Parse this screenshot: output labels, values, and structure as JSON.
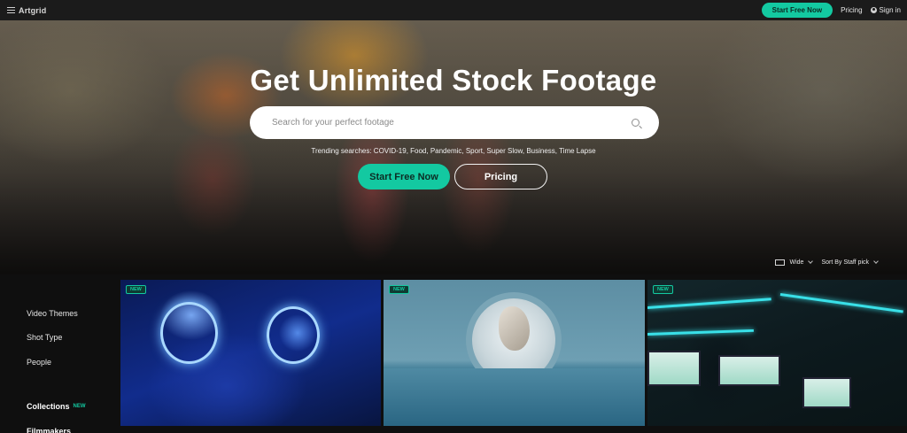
{
  "header": {
    "logo": "Artgrid",
    "start_free": "Start Free Now",
    "pricing": "Pricing",
    "sign_in": "Sign in"
  },
  "hero": {
    "title": "Get Unlimited Stock Footage",
    "search_placeholder": "Search for your perfect footage",
    "trending": "Trending searches: COVID-19, Food, Pandemic, Sport, Super Slow, Business, Time Lapse",
    "start_button": "Start Free Now",
    "pricing_button": "Pricing"
  },
  "controls": {
    "view": "Wide",
    "sort": "Sort By Staff pick"
  },
  "sidebar": {
    "items": [
      "Video Themes",
      "Shot Type",
      "People"
    ],
    "collections": "Collections",
    "collections_tag": "NEW",
    "filmmakers": "Filmmakers"
  },
  "tiles": [
    {
      "badge": "NEW",
      "subject": "astronauts-neon-helmets"
    },
    {
      "badge": "NEW",
      "subject": "floating-rock-portal"
    },
    {
      "badge": "NEW",
      "subject": "trading-office"
    }
  ],
  "colors": {
    "accent": "#13c9a1",
    "topbar": "#1b1b1b",
    "background": "#0f0f0f"
  }
}
